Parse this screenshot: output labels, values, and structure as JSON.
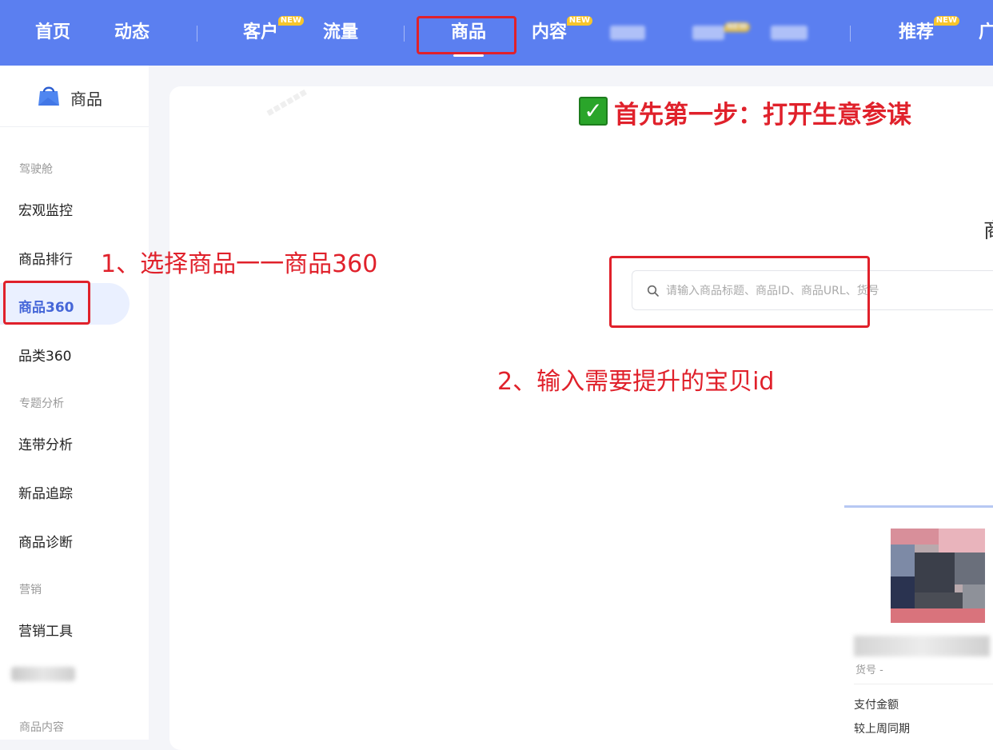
{
  "top_nav": {
    "items": [
      {
        "label": "首页",
        "badge": ""
      },
      {
        "label": "动态",
        "badge": ""
      },
      {
        "label": "客户",
        "badge": "NEW"
      },
      {
        "label": "流量",
        "badge": ""
      },
      {
        "label": "商品",
        "badge": "",
        "active": true
      },
      {
        "label": "内容",
        "badge": "NEW"
      },
      {
        "label": "推荐",
        "badge": "NEW"
      },
      {
        "label": "广",
        "badge": ""
      }
    ],
    "blurred_badges": [
      "NEW"
    ]
  },
  "sidebar": {
    "title": "商品",
    "groups": [
      {
        "label": "驾驶舱"
      },
      {
        "label": "专题分析"
      },
      {
        "label": "营销"
      },
      {
        "label": "商品内容"
      }
    ],
    "items": [
      {
        "label": "宏观监控"
      },
      {
        "label": "商品排行"
      },
      {
        "label": "商品360",
        "active": true
      },
      {
        "label": "品类360"
      },
      {
        "label": "连带分析"
      },
      {
        "label": "新品追踪"
      },
      {
        "label": "商品诊断"
      },
      {
        "label": "营销工具"
      }
    ]
  },
  "main": {
    "headline": "首先第一步：打开生意参谋",
    "check_glyph": "✓",
    "cut_title": "商",
    "search": {
      "placeholder": "请输入商品标题、商品ID、商品URL、货号",
      "value": ""
    },
    "card": {
      "sku_label": "货号 -",
      "metrics": [
        "支付金额",
        "较上周同期"
      ]
    }
  },
  "annotations": {
    "step1": "1、选择商品一一商品360",
    "step2": "2、输入需要提升的宝贝id"
  },
  "colors": {
    "nav_bg": "#5b7ff0",
    "annotation_red": "#e0212b",
    "active_blue": "#4566d8",
    "check_green": "#2aa52a"
  }
}
